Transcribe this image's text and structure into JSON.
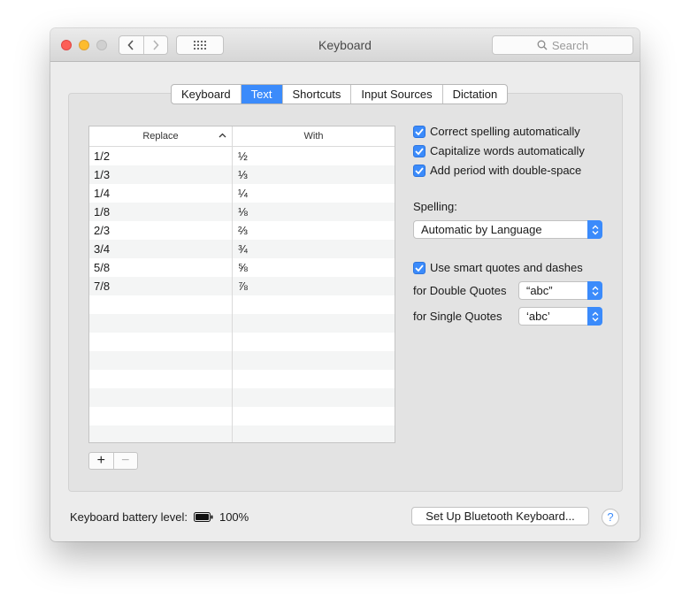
{
  "window": {
    "title": "Keyboard",
    "search_placeholder": "Search"
  },
  "tabs": [
    {
      "label": "Keyboard",
      "active": false
    },
    {
      "label": "Text",
      "active": true
    },
    {
      "label": "Shortcuts",
      "active": false
    },
    {
      "label": "Input Sources",
      "active": false
    },
    {
      "label": "Dictation",
      "active": false
    }
  ],
  "table": {
    "headers": {
      "replace": "Replace",
      "with": "With"
    },
    "rows": [
      {
        "replace": "1/2",
        "with": "½"
      },
      {
        "replace": "1/3",
        "with": "⅓"
      },
      {
        "replace": "1/4",
        "with": "¼"
      },
      {
        "replace": "1/8",
        "with": "⅛"
      },
      {
        "replace": "2/3",
        "with": "⅔"
      },
      {
        "replace": "3/4",
        "with": "¾"
      },
      {
        "replace": "5/8",
        "with": "⅝"
      },
      {
        "replace": "7/8",
        "with": "⅞"
      }
    ]
  },
  "buttons": {
    "add": "+",
    "remove": "−"
  },
  "options": {
    "correct_spelling": {
      "label": "Correct spelling automatically",
      "checked": true
    },
    "capitalize": {
      "label": "Capitalize words automatically",
      "checked": true
    },
    "add_period": {
      "label": "Add period with double-space",
      "checked": true
    },
    "spelling_label": "Spelling:",
    "spelling_value": "Automatic by Language",
    "smart_quotes": {
      "label": "Use smart quotes and dashes",
      "checked": true
    },
    "double_quotes_label": "for Double Quotes",
    "double_quotes_value": "“abc”",
    "single_quotes_label": "for Single Quotes",
    "single_quotes_value": "‘abc’"
  },
  "footer": {
    "battery_label": "Keyboard battery level:",
    "battery_value": "100%",
    "bluetooth_button": "Set Up Bluetooth Keyboard...",
    "help": "?"
  },
  "colors": {
    "accent": "#3b8bfb"
  }
}
